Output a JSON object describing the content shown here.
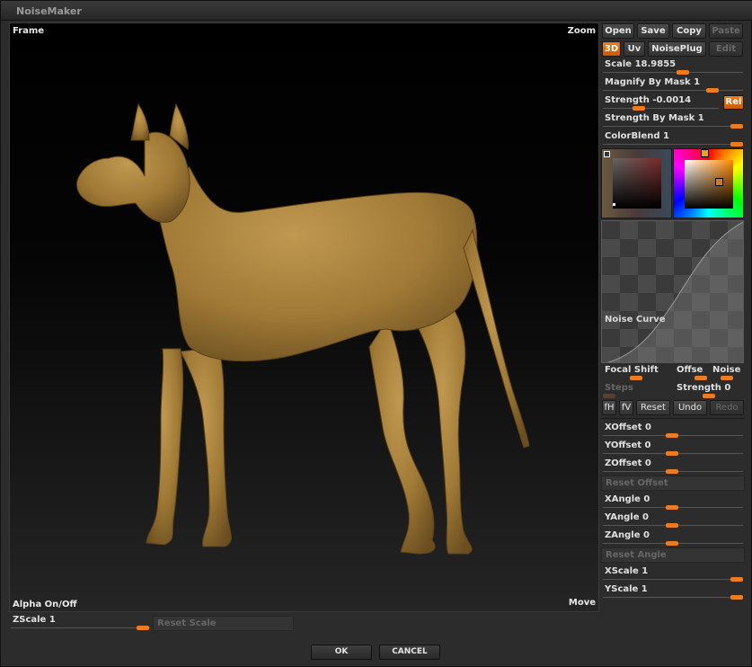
{
  "window": {
    "title": "NoiseMaker"
  },
  "viewport": {
    "frame_label": "Frame",
    "zoom_label": "Zoom",
    "alpha_label": "Alpha On/Off",
    "move_label": "Move"
  },
  "toolbar": {
    "open": "Open",
    "save": "Save",
    "copy": "Copy",
    "paste": "Paste",
    "mode_3d": "3D",
    "mode_uv": "Uv",
    "noiseplug": "NoisePlug",
    "edit": "Edit"
  },
  "params": {
    "scale": "Scale 18.9855",
    "magnify": "Magnify By Mask 1",
    "strength": "Strength -0.0014",
    "rel": "Rel",
    "strength_by_mask": "Strength By Mask 1",
    "colorblend": "ColorBlend 1"
  },
  "curve": {
    "label": "Noise Curve"
  },
  "curve_controls": {
    "focal_shift": "Focal Shift",
    "offset": "Offse",
    "noise": "Noise",
    "steps": "Steps",
    "strength": "Strength 0",
    "fh": "fH",
    "fv": "fV",
    "reset": "Reset",
    "undo": "Undo",
    "redo": "Redo"
  },
  "offsets": {
    "x": "XOffset 0",
    "y": "YOffset 0",
    "z": "ZOffset 0",
    "reset": "Reset Offset"
  },
  "angles": {
    "x": "XAngle 0",
    "y": "YAngle 0",
    "z": "ZAngle 0",
    "reset": "Reset Angle"
  },
  "scales": {
    "x": "XScale 1",
    "y": "YScale 1",
    "z": "ZScale 1",
    "reset": "Reset Scale"
  },
  "footer": {
    "ok": "OK",
    "cancel": "CANCEL"
  },
  "colors": {
    "accent": "#f07a1c",
    "model": "#a8813a"
  }
}
